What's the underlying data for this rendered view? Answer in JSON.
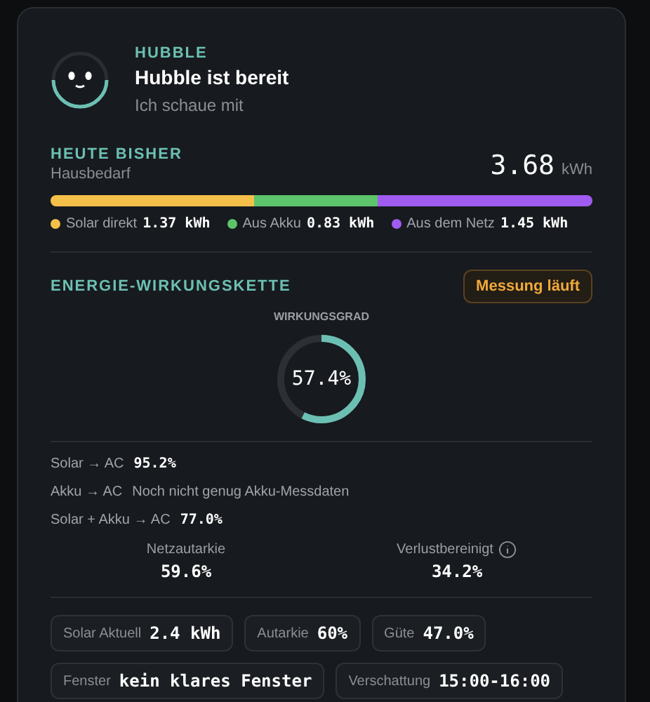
{
  "header": {
    "eyebrow": "HUBBLE",
    "title": "Hubble ist bereit",
    "subtitle": "Ich schaue mit"
  },
  "today": {
    "title": "HEUTE BISHER",
    "subtitle": "Hausbedarf",
    "value": "3.68",
    "unit": "kWh",
    "segments": [
      {
        "label": "Solar direkt",
        "value": "1.37 kWh",
        "color": "#f5c04a"
      },
      {
        "label": "Aus Akku",
        "value": "0.83 kWh",
        "color": "#5cc46a"
      },
      {
        "label": "Aus dem Netz",
        "value": "1.45 kWh",
        "color": "#a05cf0"
      }
    ]
  },
  "chain": {
    "title": "ENERGIE-WIRKUNGSKETTE",
    "badge": "Messung läuft",
    "gauge_label": "WIRKUNGSGRAD",
    "gauge_value": "57.4%",
    "rows": [
      {
        "label": "Solar → AC",
        "value": "95.2%",
        "kind": "value"
      },
      {
        "label": "Akku → AC",
        "value": "Noch nicht genug Akku-Messdaten",
        "kind": "note"
      },
      {
        "label": "Solar + Akku → AC",
        "value": "77.0%",
        "kind": "value"
      }
    ],
    "stats": [
      {
        "label": "Netzautarkie",
        "value": "59.6%",
        "info": false
      },
      {
        "label": "Verlustbereinigt",
        "value": "34.2%",
        "info": true
      }
    ]
  },
  "chips": [
    [
      {
        "label": "Solar Aktuell",
        "value": "2.4 kWh"
      },
      {
        "label": "Autarkie",
        "value": "60%"
      },
      {
        "label": "Güte",
        "value": "47.0%"
      }
    ],
    [
      {
        "label": "Fenster",
        "value": "kein klares Fenster"
      },
      {
        "label": "Verschattung",
        "value": "15:00-16:00"
      }
    ]
  ]
}
